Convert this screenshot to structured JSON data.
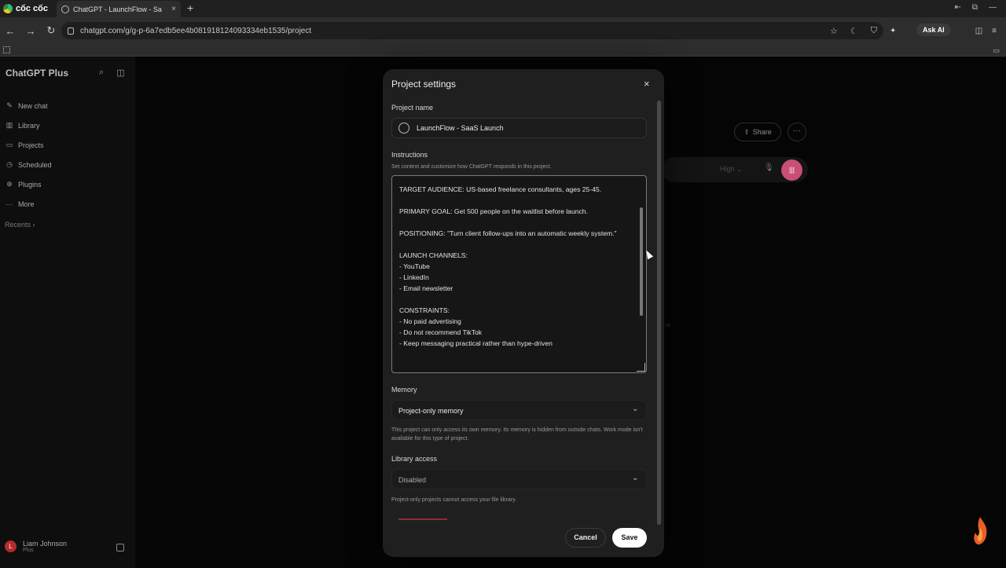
{
  "browser": {
    "brand": "cốc cốc",
    "tab_title": "ChatGPT - LaunchFlow - Sa",
    "tab_close": "×",
    "new_tab": "+",
    "url": "chatgpt.com/g/g-p-6a7edb5ee4b081918124093334eb1535/project",
    "ask_ai": "Ask AI",
    "icons": [
      "back-icon",
      "forward-icon",
      "reload-icon",
      "lock-icon",
      "star-icon",
      "moon-icon",
      "shield-icon",
      "puzzle-icon",
      "sidepanel-icon",
      "menu-icon",
      "apps-icon",
      "folder-icon"
    ]
  },
  "sidebar": {
    "title": "ChatGPT Plus",
    "items": [
      {
        "label": "New chat",
        "icon": "edit-icon"
      },
      {
        "label": "Library",
        "icon": "library-icon"
      },
      {
        "label": "Projects",
        "icon": "folder-icon"
      },
      {
        "label": "Scheduled",
        "icon": "clock-icon"
      },
      {
        "label": "Plugins",
        "icon": "plugin-icon"
      },
      {
        "label": "More",
        "icon": "more-icon"
      }
    ],
    "recents": "Recents ›",
    "user": {
      "name": "Liam Johnson",
      "plan": "Plus",
      "initial": "L"
    }
  },
  "main": {
    "share_label": "Share",
    "more_label": "···",
    "composer_model": "High ⌄",
    "faint_text": "ce"
  },
  "modal": {
    "title": "Project settings",
    "close": "×",
    "project_name_label": "Project name",
    "project_name_value": "LaunchFlow - SaaS Launch",
    "instructions_label": "Instructions",
    "instructions_hint": "Set context and customize how ChatGPT responds in this project.",
    "instructions_text": "TARGET AUDIENCE: US-based freelance consultants, ages 25-45.\n\nPRIMARY GOAL: Get 500 people on the waitlist before launch.\n\nPOSITIONING: \"Turn client follow-ups into an automatic weekly system.\"\n\nLAUNCH CHANNELS:\n- YouTube\n- LinkedIn\n- Email newsletter\n\nCONSTRAINTS:\n- No paid advertising\n- Do not recommend TikTok\n- Keep messaging practical rather than hype-driven",
    "memory_label": "Memory",
    "memory_value": "Project-only memory",
    "memory_hint": "This project can only access its own memory. Its memory is hidden from outside chats. Work mode isn't available for this type of project.",
    "library_label": "Library access",
    "library_value": "Disabled",
    "library_hint": "Project-only projects cannot access your file library.",
    "cancel_label": "Cancel",
    "save_label": "Save"
  }
}
